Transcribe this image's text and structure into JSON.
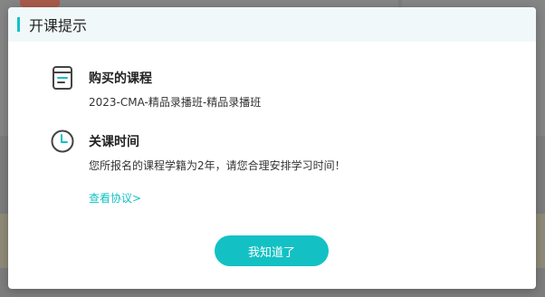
{
  "modal": {
    "title": "开课提示",
    "course": {
      "icon": "book-icon",
      "heading": "购买的课程",
      "name": "2023-CMA-精品录播班-精品录播班"
    },
    "close_time": {
      "icon": "clock-icon",
      "heading": "关课时间",
      "text": "您所报名的课程学籍为2年，请您合理安排学习时间！"
    },
    "agreement_link": "查看协议>",
    "ok_button": "我知道了"
  },
  "colors": {
    "accent": "#13c1c4",
    "header_bg": "#f0f8fa",
    "overlay": "#7d7d7d"
  }
}
